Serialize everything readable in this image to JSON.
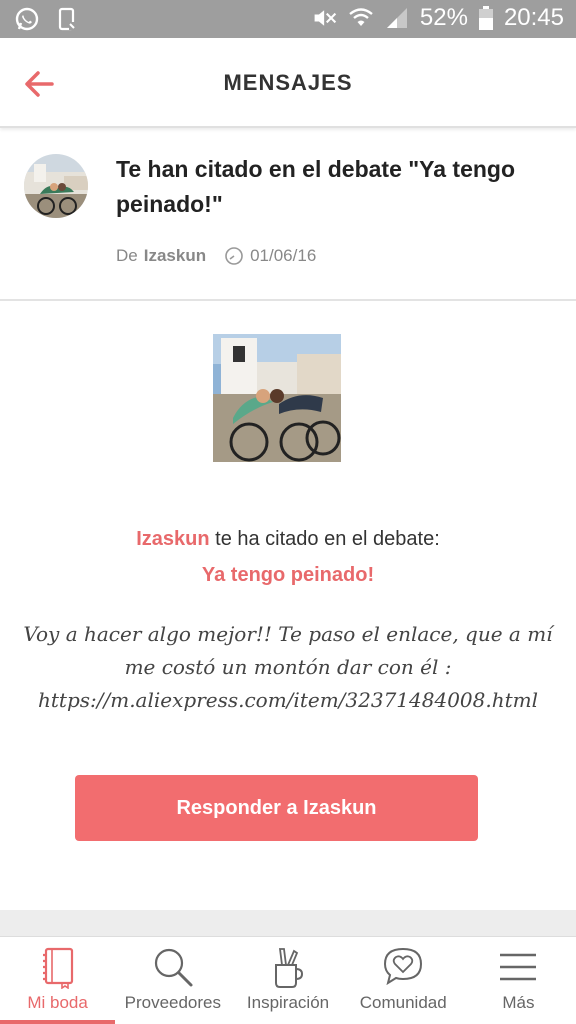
{
  "status": {
    "battery": "52%",
    "time": "20:45"
  },
  "header": {
    "title": "MENSAJES"
  },
  "message": {
    "title": "Te han citado en el debate \"Ya tengo peinado!\"",
    "from_prefix": "De",
    "author": "Izaskun",
    "date": "01/06/16"
  },
  "body": {
    "cited_name": "Izaskun",
    "cited_text": " te ha citado en el debate:",
    "debate_title": "Ya tengo peinado!",
    "quote": "Voy a hacer algo mejor!! Te paso el enlace, que a mí me costó un montón dar con él : https://m.aliexpress.com/item/32371484008.html"
  },
  "reply_button": "Responder a Izaskun",
  "tabs": [
    {
      "label": "Mi boda",
      "icon": "notebook-icon",
      "active": true
    },
    {
      "label": "Proveedores",
      "icon": "search-icon",
      "active": false
    },
    {
      "label": "Inspiración",
      "icon": "pencil-cup-icon",
      "active": false
    },
    {
      "label": "Comunidad",
      "icon": "heart-chat-icon",
      "active": false
    },
    {
      "label": "Más",
      "icon": "menu-icon",
      "active": false
    }
  ],
  "colors": {
    "accent": "#e8696b",
    "button": "#f26d6f",
    "statusbar": "#9e9e9e"
  }
}
